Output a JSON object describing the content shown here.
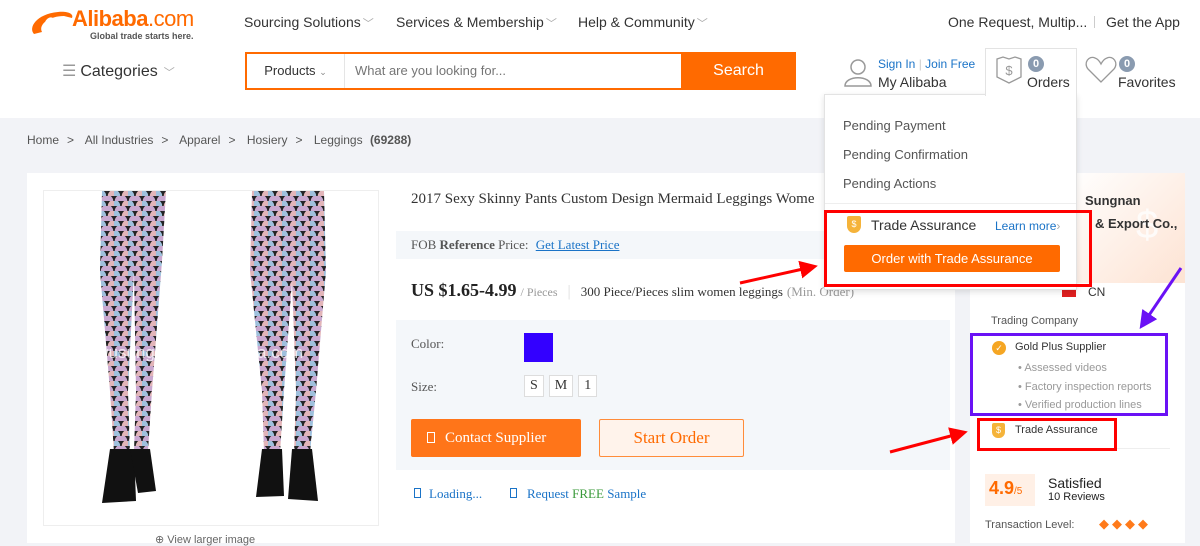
{
  "header": {
    "logo": {
      "brand": "Alibaba",
      "brand_suffix": ".com",
      "tagline": "Global trade starts here."
    },
    "nav": [
      {
        "label": "Sourcing Solutions"
      },
      {
        "label": "Services & Membership"
      },
      {
        "label": "Help & Community"
      }
    ],
    "top_right": {
      "request": "One Request, Multip...",
      "app": "Get the App"
    },
    "categories_label": "Categories",
    "search": {
      "category": "Products",
      "placeholder": "What are you looking for...",
      "button": "Search"
    },
    "account": {
      "sign_in": "Sign In",
      "join": "Join Free",
      "my_alibaba": "My Alibaba"
    },
    "orders": {
      "count": "0",
      "label": "Orders"
    },
    "favorites": {
      "count": "0",
      "label": "Favorites"
    }
  },
  "orders_dropdown": {
    "items": [
      "Pending Payment",
      "Pending Confirmation",
      "Pending Actions"
    ],
    "trade_assurance": "Trade Assurance",
    "learn_more": "Learn more",
    "order_button": "Order with Trade Assurance"
  },
  "breadcrumb": {
    "items": [
      "Home",
      "All Industries",
      "Apparel",
      "Hosiery",
      "Leggings"
    ],
    "count": "(69288)"
  },
  "product": {
    "watermark": "yiwusungnan.en.alibaba.com",
    "view_larger": "View larger image",
    "title": "2017 Sexy Skinny Pants Custom Design Mermaid Leggings Wome",
    "fob_prefix": "FOB",
    "fob_ref": "Reference",
    "fob_suffix": "Price:",
    "get_latest_price": "Get Latest Price",
    "price": "US $1.65-4.99",
    "unit": "/ Pieces",
    "moq": "300 Piece/Pieces slim women leggings",
    "moq_suffix": "(Min. Order)",
    "color_label": "Color:",
    "color_swatch": "#3300ff",
    "size_label": "Size:",
    "sizes": [
      "S",
      "M",
      "1"
    ],
    "contact_button": "Contact Supplier",
    "start_order_button": "Start Order",
    "loading": "Loading...",
    "request": "Request",
    "free": "FREE",
    "sample": "Sample"
  },
  "supplier": {
    "name_line1": "Sungnan",
    "name_line2": "& Export Co.,",
    "country": "CN",
    "type": "Trading Company",
    "gold_plus": "Gold Plus Supplier",
    "features": [
      "Assessed videos",
      "Factory inspection reports",
      "Verified production lines"
    ],
    "trade_assurance": "Trade Assurance",
    "rating": "4.9",
    "rating_max": "/5",
    "satisfaction": "Satisfied",
    "reviews": "10 Reviews",
    "transaction_level_label": "Transaction Level:",
    "transaction_level": 4
  },
  "colors": {
    "accent": "#ff6a00",
    "annotation_red": "#ff0000",
    "annotation_purple": "#6a11f5",
    "link": "#1a73c7"
  }
}
